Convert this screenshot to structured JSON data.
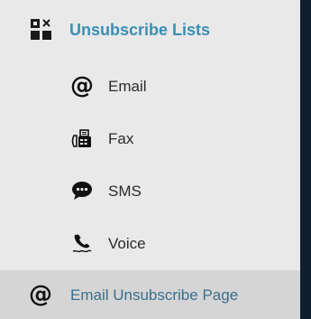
{
  "menu": {
    "header": {
      "label": "Unsubscribe Lists",
      "icon": "grid-x-icon"
    },
    "items": [
      {
        "label": "Email",
        "icon": "at-icon"
      },
      {
        "label": "Fax",
        "icon": "fax-icon"
      },
      {
        "label": "SMS",
        "icon": "chat-bubble-icon"
      },
      {
        "label": "Voice",
        "icon": "phone-icon"
      }
    ],
    "active_item": {
      "label": "Email Unsubscribe Page",
      "icon": "at-icon"
    }
  },
  "colors": {
    "background": "#0f1f2e",
    "panel": "#e9e9e9",
    "active_row": "#d5d5d5",
    "header_text": "#3a8fb4",
    "active_text": "#3a6f8f"
  }
}
